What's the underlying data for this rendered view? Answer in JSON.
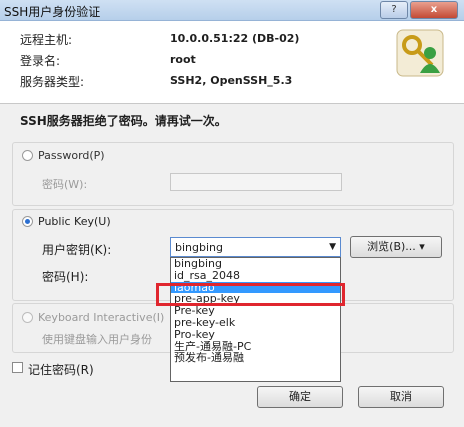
{
  "window": {
    "title": "SSH用户身份验证",
    "help_label": "?",
    "close_label": "x"
  },
  "info": {
    "host_label": "远程主机:",
    "host_value": "10.0.0.51:22 (DB-02)",
    "login_label": "登录名:",
    "login_value": "root",
    "server_type_label": "服务器类型:",
    "server_type_value": "SSH2, OpenSSH_5.3"
  },
  "message": "SSH服务器拒绝了密码。请再试一次。",
  "password_group": {
    "radio_label": "Password(P)",
    "password_label": "密码(W):",
    "selected": false
  },
  "publickey_group": {
    "radio_label": "Public Key(U)",
    "user_key_label": "用户密钥(K):",
    "selected_key": "bingbing",
    "passphrase_label": "密码(H):",
    "browse_label": "浏览(B)...",
    "selected": true
  },
  "keyboard_group": {
    "radio_label": "Keyboard Interactive(I)",
    "desc": "使用键盘输入用户身份",
    "selected": false
  },
  "dropdown_items": [
    "bingbing",
    "id_rsa_2048",
    "laomao",
    "pre-app-key",
    "Pre-key",
    "pre-key-elk",
    "Pro-key",
    "生产-通易融-PC",
    "预发布-通易融"
  ],
  "dropdown_selected_index": 2,
  "remember_label": "记住密码(R)",
  "ok_label": "确定",
  "cancel_label": "取消",
  "colors": {
    "selection": "#3399ff",
    "annotation": "#e0262e"
  }
}
